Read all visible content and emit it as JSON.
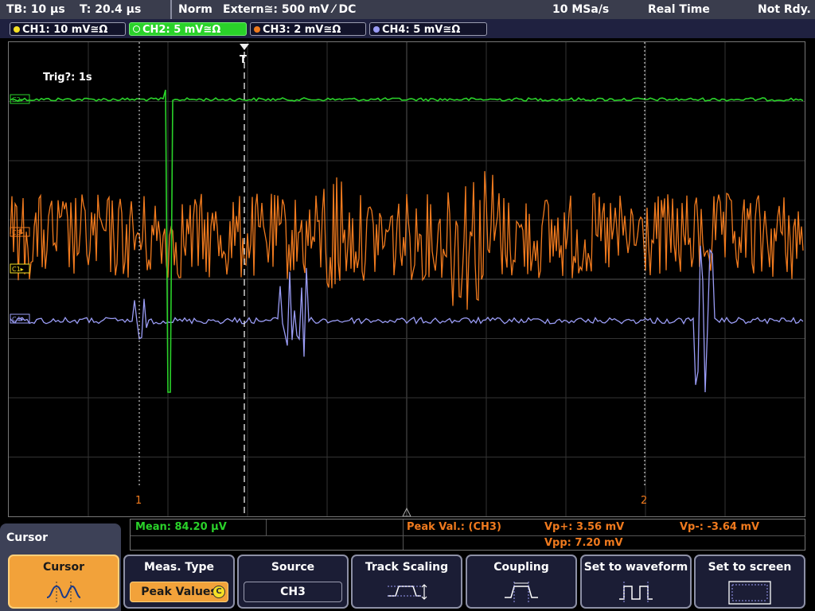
{
  "status_bar": {
    "timebase": "TB: 10 µs",
    "trigger_time": "T: 20.4 µs",
    "trigger_mode": "Norm",
    "trigger_source": "Extern≅: 500 mV ⁄ DC",
    "sample_rate": "10 MSa/s",
    "acquisition": "Real Time",
    "ready_state": "Not Rdy."
  },
  "channels": [
    {
      "label": "CH1: 10 mV≅Ω",
      "color": "#f5e025",
      "active": false
    },
    {
      "label": "CH2: 5 mV≅Ω",
      "color": "#2ad22a",
      "active": true
    },
    {
      "label": "CH3: 2 mV≅Ω",
      "color": "#f07a1e",
      "active": false
    },
    {
      "label": "CH4: 5 mV≅Ω",
      "color": "#9a9cf5",
      "active": false
    }
  ],
  "display": {
    "trigger_status": "Trig?: 1s",
    "trigger_marker": "T",
    "cursor1_label": "1",
    "cursor2_label": "2",
    "ch_markers": {
      "ch2": "C2▸",
      "ch3": "C3▸",
      "ch1": "C1▸",
      "ch4": "C4▸"
    }
  },
  "measurements": {
    "mean": "Mean: 84.20 µV",
    "peak_title": "Peak Val.:  (CH3)",
    "vp_plus": "Vp+: 3.56 mV",
    "vp_minus": "Vp-: -3.64 mV",
    "vpp": "Vpp: 7.20 mV"
  },
  "menu": {
    "title": "Cursor",
    "softkeys": [
      {
        "title": "Cursor",
        "sub": "",
        "icon": "cursor-waveform-icon",
        "active": true
      },
      {
        "title": "Meas. Type",
        "sub": "Peak Values",
        "icon": "",
        "active": false
      },
      {
        "title": "Source",
        "sub": "CH3",
        "icon": "",
        "active": false
      },
      {
        "title": "Track Scaling",
        "sub": "",
        "icon": "track-scaling-icon",
        "active": false
      },
      {
        "title": "Coupling",
        "sub": "",
        "icon": "coupling-icon",
        "active": false
      },
      {
        "title": "Set to waveform",
        "sub": "",
        "icon": "set-to-waveform-icon",
        "active": false
      },
      {
        "title": "Set to screen",
        "sub": "",
        "icon": "set-to-screen-icon",
        "active": false
      }
    ]
  },
  "colors": {
    "ch1": "#f5e025",
    "ch2": "#2ad22a",
    "ch3": "#f07a1e",
    "ch4": "#9a9cf5",
    "grid": "#3a3a3a",
    "cursor": "#f07a1e"
  }
}
